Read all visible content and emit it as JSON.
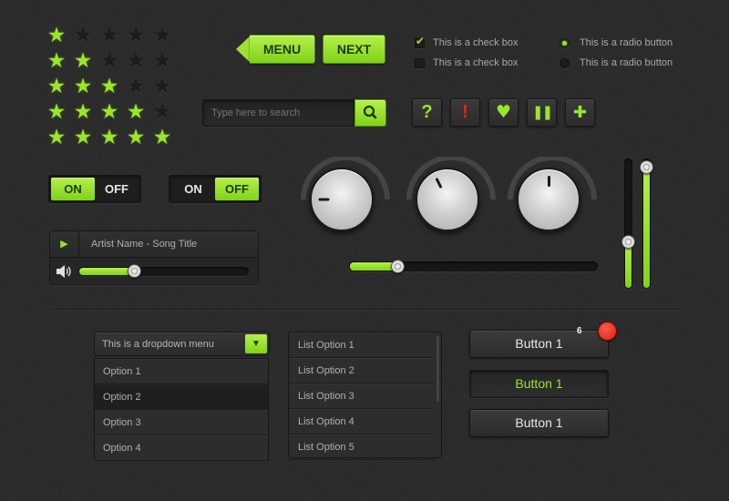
{
  "colors": {
    "accent": "#9ae62a",
    "background": "#2b2b2b",
    "alert": "#e3241a"
  },
  "ratings": [
    1,
    2,
    3,
    4,
    5
  ],
  "rating_max": 5,
  "nav": {
    "menu_label": "MENU",
    "next_label": "NEXT"
  },
  "checkboxes": [
    {
      "label": "This is a check box",
      "checked": true
    },
    {
      "label": "This is a check box",
      "checked": false
    }
  ],
  "radios": [
    {
      "label": "This is a radio button",
      "selected": true
    },
    {
      "label": "This is a radio button",
      "selected": false
    }
  ],
  "search": {
    "placeholder": "Type here to search",
    "button_icon": "search-icon"
  },
  "icon_buttons": [
    {
      "icon": "help-icon",
      "glyph": "?"
    },
    {
      "icon": "alert-icon",
      "glyph": "!"
    },
    {
      "icon": "heart-icon",
      "glyph": "♥"
    },
    {
      "icon": "pause-icon",
      "glyph": "❚❚"
    },
    {
      "icon": "plus-icon",
      "glyph": "✚"
    }
  ],
  "toggles": [
    {
      "on_label": "ON",
      "off_label": "OFF",
      "state": "on"
    },
    {
      "on_label": "ON",
      "off_label": "OFF",
      "state": "off"
    }
  ],
  "player": {
    "track": "Artist Name - Song Title",
    "volume": 0.33,
    "play_icon": "play-icon",
    "volume_icon": "speaker-icon"
  },
  "knobs": [
    {
      "value": 0.0
    },
    {
      "value": 0.35
    },
    {
      "value": 0.5
    }
  ],
  "horizontal_slider": {
    "value": 0.19
  },
  "vertical_sliders": [
    {
      "value": 0.37
    },
    {
      "value": 0.95
    }
  ],
  "dropdown": {
    "selected": "This is a dropdown menu",
    "options": [
      "Option 1",
      "Option 2",
      "Option 3",
      "Option 4"
    ],
    "highlighted_index": 1
  },
  "listbox": {
    "options": [
      "List Option 1",
      "List Option 2",
      "List Option 3",
      "List Option 4",
      "List Option 5"
    ]
  },
  "buttons": [
    {
      "label": "Button 1",
      "state": "normal",
      "badge": "6"
    },
    {
      "label": "Button 1",
      "state": "pressed"
    },
    {
      "label": "Button 1",
      "state": "normal"
    }
  ]
}
